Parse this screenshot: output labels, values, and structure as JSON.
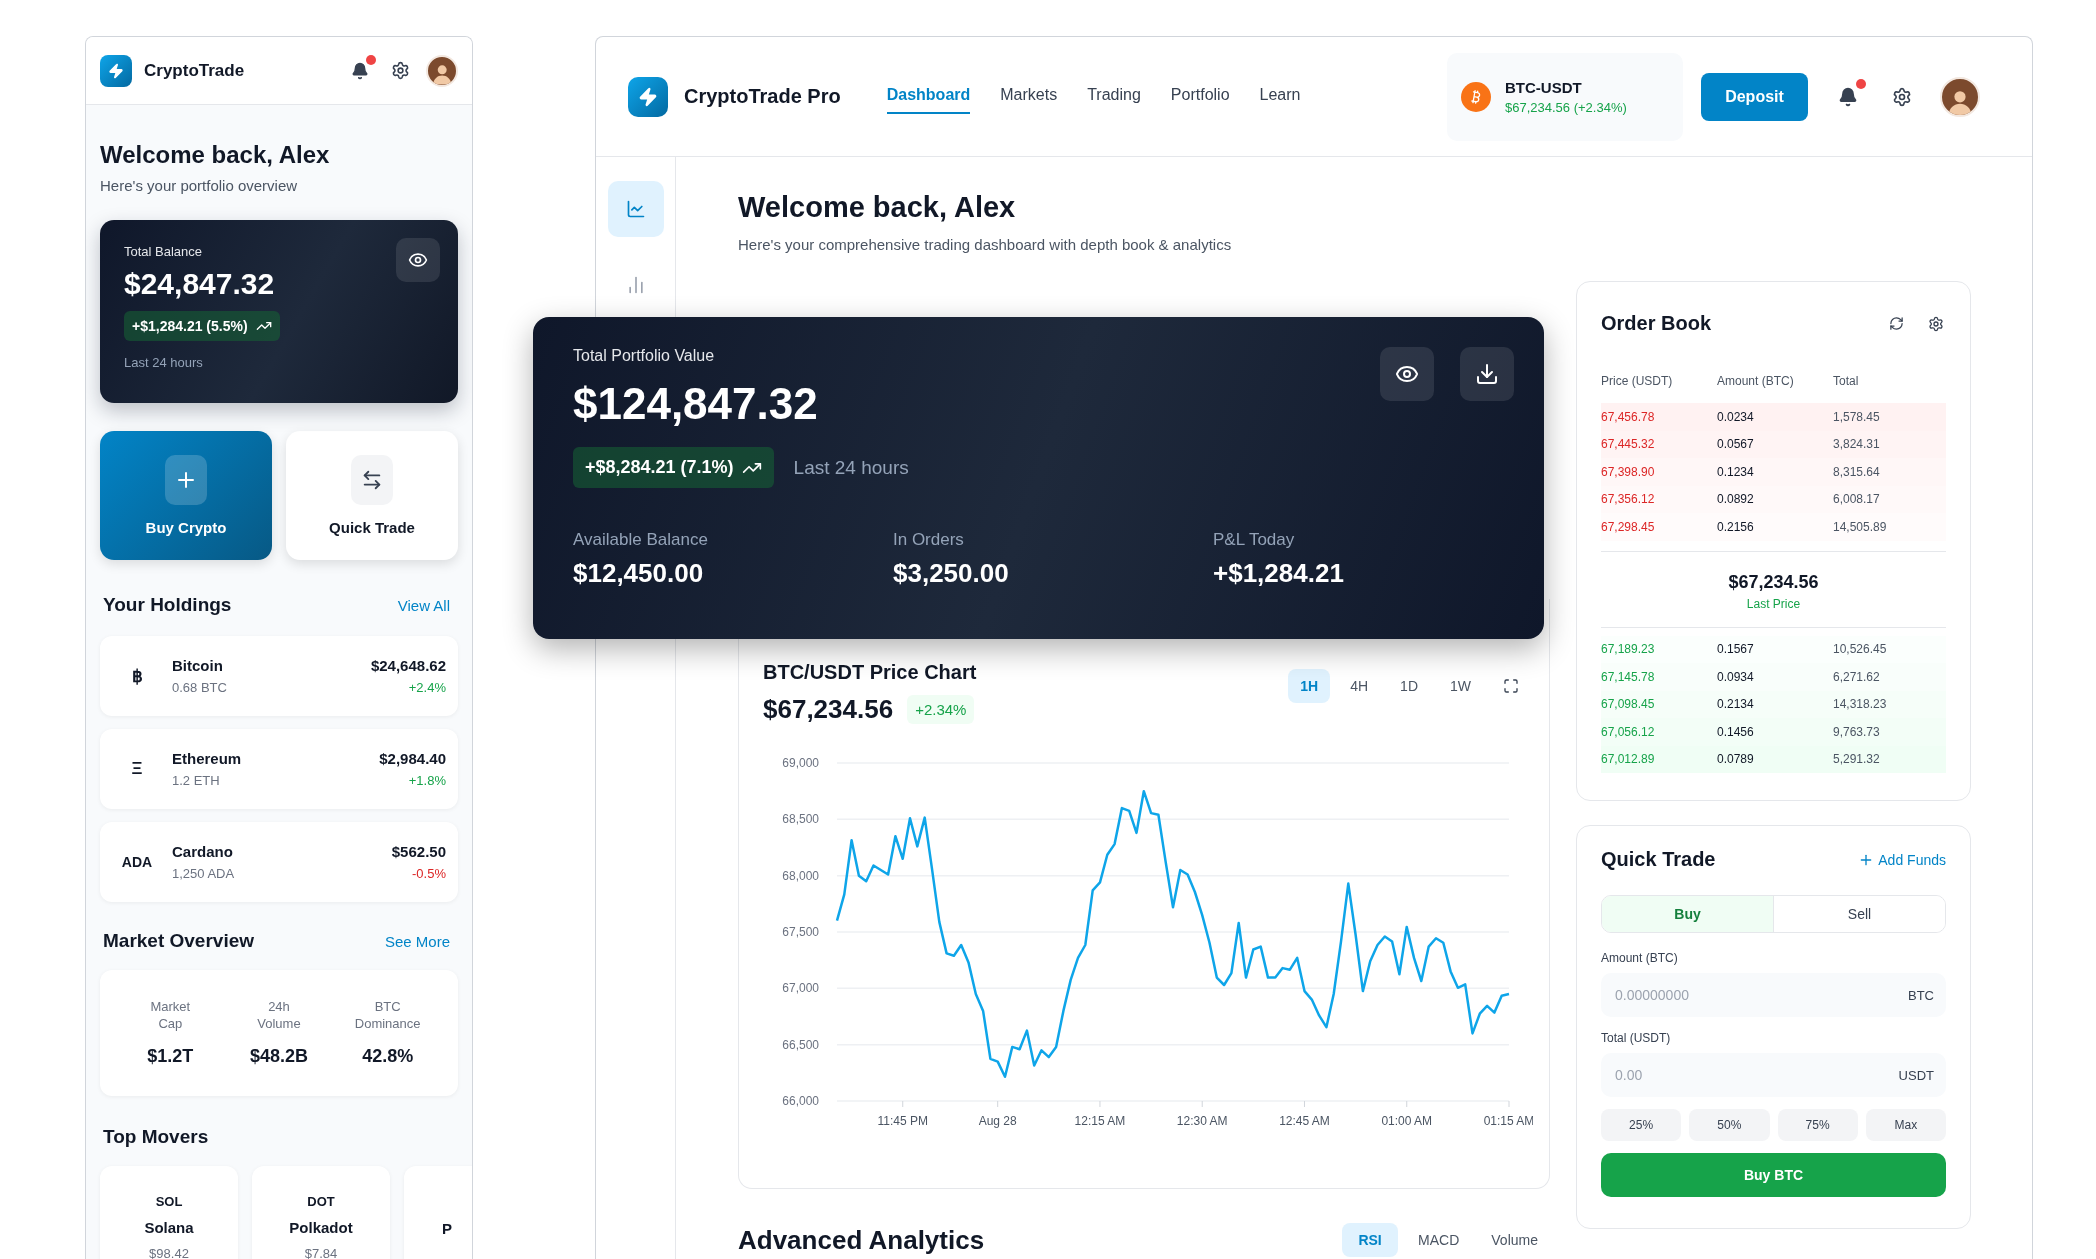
{
  "mobile": {
    "brand": "CryptoTrade",
    "welcome": {
      "title": "Welcome back, Alex",
      "subtitle": "Here's your portfolio overview"
    },
    "balance": {
      "label": "Total Balance",
      "value": "$24,847.32",
      "change": "+$1,284.21 (5.5%)",
      "period": "Last 24 hours"
    },
    "actions": [
      {
        "label": "Buy Crypto",
        "kind": "primary"
      },
      {
        "label": "Quick Trade",
        "kind": "secondary"
      }
    ],
    "holdings": {
      "title": "Your Holdings",
      "link": "View All",
      "items": [
        {
          "symbol": "฿",
          "name": "Bitcoin",
          "amount": "0.68 BTC",
          "value": "$24,648.62",
          "change": "+2.4%",
          "kind": "gain"
        },
        {
          "symbol": "Ξ",
          "name": "Ethereum",
          "amount": "1.2 ETH",
          "value": "$2,984.40",
          "change": "+1.8%",
          "kind": "gain"
        },
        {
          "symbol": "ADA",
          "name": "Cardano",
          "amount": "1,250 ADA",
          "value": "$562.50",
          "change": "-0.5%",
          "kind": "loss"
        }
      ]
    },
    "market": {
      "title": "Market Overview",
      "link": "See More",
      "stats": [
        {
          "label": "Market Cap",
          "value": "$1.2T"
        },
        {
          "label": "24h Volume",
          "value": "$48.2B"
        },
        {
          "label": "BTC Dominance",
          "value": "42.8%"
        }
      ]
    },
    "movers": {
      "title": "Top Movers",
      "items": [
        {
          "symbol": "SOL",
          "name": "Solana",
          "price": "$98.42"
        },
        {
          "symbol": "DOT",
          "name": "Polkadot",
          "price": "$7.84"
        },
        {
          "name": "P"
        }
      ]
    }
  },
  "main": {
    "brand": "CryptoTrade Pro",
    "nav": [
      {
        "label": "Dashboard",
        "selected": true
      },
      {
        "label": "Markets",
        "selected": false
      },
      {
        "label": "Trading",
        "selected": false
      },
      {
        "label": "Portfolio",
        "selected": false
      },
      {
        "label": "Learn",
        "selected": false
      }
    ],
    "ticker": {
      "pair": "BTC-USDT",
      "price": "$67,234.56 (+2.34%)"
    },
    "deposit": "Deposit",
    "sidebar": [
      {
        "kind": "line-chart",
        "selected": true
      },
      {
        "kind": "bar-chart",
        "selected": false
      }
    ],
    "welcome": {
      "title": "Welcome back, Alex",
      "subtitle": "Here's your comprehensive trading dashboard with depth book & analytics"
    },
    "portfolio": {
      "label": "Total Portfolio Value",
      "value": "$124,847.32",
      "change": "+$8,284.21 (7.1%)",
      "period": "Last 24 hours",
      "stats": [
        {
          "label": "Available Balance",
          "value": "$12,450.00"
        },
        {
          "label": "In Orders",
          "value": "$3,250.00"
        },
        {
          "label": "P&L Today",
          "value": "+$1,284.21"
        }
      ]
    },
    "price_chart": {
      "title": "BTC/USDT Price Chart",
      "price": "$67,234.56",
      "change": "+2.34%",
      "timeframes": [
        {
          "label": "1H",
          "selected": true
        },
        {
          "label": "4H",
          "selected": false
        },
        {
          "label": "1D",
          "selected": false
        },
        {
          "label": "1W",
          "selected": false
        }
      ],
      "chart_data": {
        "type": "line",
        "grid": true,
        "ylim": [
          66000,
          69000
        ],
        "categories": [
          null,
          null,
          null,
          null,
          null,
          null,
          null,
          null,
          null,
          "11:45 PM",
          null,
          null,
          null,
          null,
          null,
          null,
          null,
          null,
          null,
          null,
          null,
          null,
          "Aug 28",
          null,
          null,
          null,
          null,
          null,
          null,
          null,
          null,
          null,
          null,
          null,
          null,
          null,
          "12:15 AM",
          null,
          null,
          null,
          null,
          null,
          null,
          null,
          null,
          null,
          null,
          null,
          null,
          null,
          "12:30 AM",
          null,
          null,
          null,
          null,
          null,
          null,
          null,
          null,
          null,
          null,
          null,
          null,
          null,
          "12:45 AM",
          null,
          null,
          null,
          null,
          null,
          null,
          null,
          null,
          null,
          null,
          null,
          null,
          null,
          "01:00 AM",
          null,
          null,
          null,
          null,
          null,
          null,
          null,
          null,
          null,
          null,
          null,
          null,
          null,
          "01:15 AM"
        ],
        "yticks": [
          {
            "value": 66000,
            "label": "66,000"
          },
          {
            "value": 66500,
            "label": "66,500"
          },
          {
            "value": 67000,
            "label": "67,000"
          },
          {
            "value": 67500,
            "label": "67,500"
          },
          {
            "value": 68000,
            "label": "68,000"
          },
          {
            "value": 68500,
            "label": "68,500"
          },
          {
            "value": 69000,
            "label": "69,000"
          }
        ],
        "series": [
          {
            "color": "#0ea5e9",
            "values": [
              67600,
              67835,
              68315,
              68000,
              67950,
              68090,
              68050,
              68010,
              68350,
              68150,
              68510,
              68260,
              68515,
              68060,
              67590,
              67310,
              67290,
              67385,
              67230,
              66950,
              66800,
              66375,
              66350,
              66215,
              66480,
              66460,
              66625,
              66315,
              66450,
              66390,
              66480,
              66800,
              67075,
              67270,
              67385,
              67870,
              67940,
              68185,
              68280,
              68600,
              68575,
              68380,
              68750,
              68555,
              68540,
              68120,
              67720,
              68050,
              68010,
              67855,
              67650,
              67405,
              67095,
              67030,
              67135,
              67580,
              67095,
              67345,
              67370,
              67095,
              67095,
              67180,
              67165,
              67270,
              66975,
              66900,
              66760,
              66655,
              66950,
              67415,
              67930,
              67475,
              66975,
              67240,
              67385,
              67460,
              67415,
              67125,
              67545,
              67270,
              67065,
              67370,
              67445,
              67405,
              67150,
              67005,
              67035,
              66600,
              66775,
              66845,
              66785,
              66935,
              66950
            ]
          }
        ]
      }
    },
    "order_book": {
      "title": "Order Book",
      "columns": [
        "Price (USDT)",
        "Amount (BTC)",
        "Total"
      ],
      "asks": [
        {
          "price": "67,456.78",
          "amount": "0.0234",
          "total": "1,578.45"
        },
        {
          "price": "67,445.32",
          "amount": "0.0567",
          "total": "3,824.31"
        },
        {
          "price": "67,398.90",
          "amount": "0.1234",
          "total": "8,315.64"
        },
        {
          "price": "67,356.12",
          "amount": "0.0892",
          "total": "6,008.17"
        },
        {
          "price": "67,298.45",
          "amount": "0.2156",
          "total": "14,505.89"
        }
      ],
      "last_price": "$67,234.56",
      "last_label": "Last Price",
      "bids": [
        {
          "price": "67,189.23",
          "amount": "0.1567",
          "total": "10,526.45"
        },
        {
          "price": "67,145.78",
          "amount": "0.0934",
          "total": "6,271.62"
        },
        {
          "price": "67,098.45",
          "amount": "0.2134",
          "total": "14,318.23"
        },
        {
          "price": "67,056.12",
          "amount": "0.1456",
          "total": "9,763.73"
        },
        {
          "price": "67,012.89",
          "amount": "0.0789",
          "total": "5,291.32"
        }
      ]
    },
    "quick_trade": {
      "title": "Quick Trade",
      "add_funds": "Add Funds",
      "sides": [
        {
          "label": "Buy",
          "selected": true
        },
        {
          "label": "Sell",
          "selected": false
        }
      ],
      "fields": [
        {
          "label": "Amount (BTC)",
          "placeholder": "0.00000000",
          "unit": "BTC"
        },
        {
          "label": "Total (USDT)",
          "placeholder": "0.00",
          "unit": "USDT"
        }
      ],
      "percents": [
        "25%",
        "50%",
        "75%",
        "Max"
      ],
      "submit": "Buy BTC"
    },
    "analytics": {
      "title": "Advanced Analytics",
      "tabs": [
        {
          "label": "RSI",
          "selected": true
        },
        {
          "label": "MACD",
          "selected": false
        },
        {
          "label": "Volume",
          "selected": false
        }
      ]
    }
  }
}
